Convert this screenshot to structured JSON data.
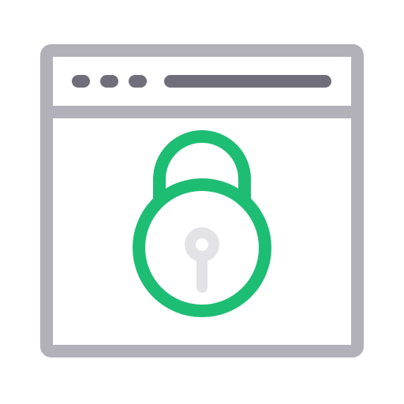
{
  "icon": {
    "name": "secure-browser-lock-icon",
    "parts": [
      "browser-window-icon",
      "window-dot-icon",
      "address-bar-icon",
      "padlock-icon",
      "keyhole-icon"
    ]
  },
  "colors": {
    "background": "#ffffff",
    "window_frame": "#b2b0b8",
    "toolbar_elements": "#716e7b",
    "lock": "#1ebd74",
    "keyhole": "#e3e2e6"
  }
}
